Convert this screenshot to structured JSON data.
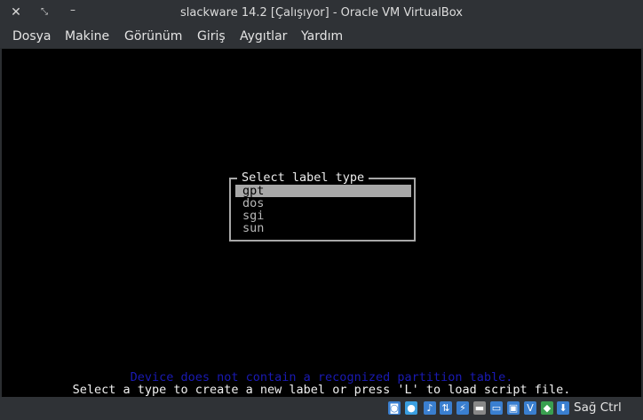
{
  "window": {
    "title": "slackware 14.2 [Çalışıyor] - Oracle VM VirtualBox",
    "close_glyph": "✕",
    "maximize_glyph": "⤡",
    "minimize_glyph": "–"
  },
  "menu": {
    "items": [
      "Dosya",
      "Makine",
      "Görünüm",
      "Giriş",
      "Aygıtlar",
      "Yardım"
    ]
  },
  "dialog": {
    "title": "Select label type",
    "options": [
      "gpt",
      "dos",
      "sgi",
      "sun"
    ],
    "selected": "gpt"
  },
  "messages": {
    "warning": "Device does not contain a recognized partition table.",
    "hint": "Select a type to create a new label or press 'L' to load script file."
  },
  "statusbar": {
    "icons": [
      {
        "name": "hard-disk-icon",
        "glyph": "◙",
        "color": "#3a7fd0"
      },
      {
        "name": "optical-drive-icon",
        "glyph": "●",
        "color": "#3a9fe0"
      },
      {
        "name": "audio-icon",
        "glyph": "♪",
        "color": "#3a7fd0"
      },
      {
        "name": "network-icon",
        "glyph": "⇅",
        "color": "#3a7fd0"
      },
      {
        "name": "usb-icon",
        "glyph": "⚡",
        "color": "#3a7fd0"
      },
      {
        "name": "shared-folders-icon",
        "glyph": "▬",
        "color": "#888888"
      },
      {
        "name": "display-icon",
        "glyph": "▭",
        "color": "#3a7fd0"
      },
      {
        "name": "video-capture-icon",
        "glyph": "▣",
        "color": "#3a7fd0"
      },
      {
        "name": "virtualization-icon",
        "glyph": "V",
        "color": "#3a7fd0"
      },
      {
        "name": "mouse-integration-icon",
        "glyph": "◆",
        "color": "#3aa050"
      },
      {
        "name": "keyboard-capture-icon",
        "glyph": "⬇",
        "color": "#3a7fd0"
      }
    ],
    "host_key": "Sağ Ctrl"
  }
}
